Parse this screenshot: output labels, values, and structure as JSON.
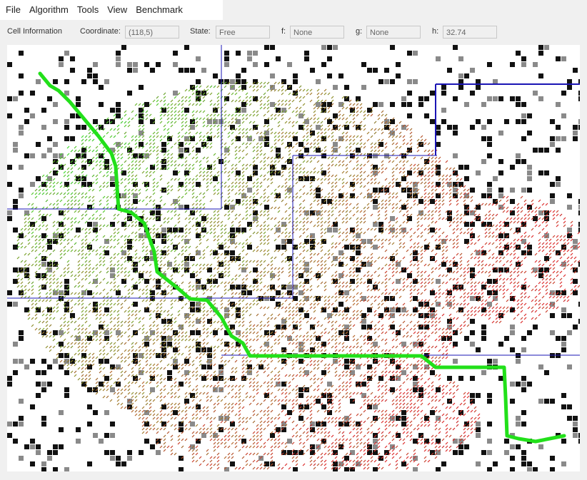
{
  "menu": [
    "File",
    "Algorithm",
    "Tools",
    "View",
    "Benchmark"
  ],
  "cell_info": {
    "section_label": "Cell Information",
    "coordinate_label": "Coordinate:",
    "coordinate_value": "(118,5)",
    "state_label": "State:",
    "state_value": "Free",
    "f_label": "f:",
    "f_value": "None",
    "g_label": "g:",
    "g_value": "None",
    "h_label": "h:",
    "h_value": "32.74"
  },
  "colors": {
    "path": "#22e01a",
    "boundary": "#1a14b4",
    "obstacle": "#111111",
    "visited_start": "#2ee02c",
    "visited_mid": "#8a8a2e",
    "visited_end": "#d22a1e"
  }
}
